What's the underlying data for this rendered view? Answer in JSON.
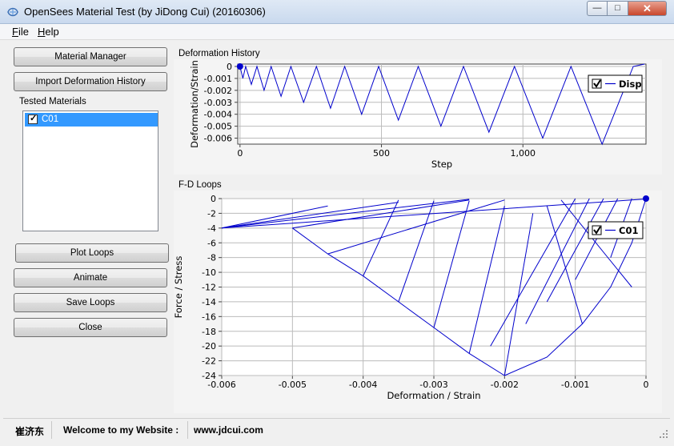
{
  "window": {
    "title": "OpenSees Material Test (by JiDong Cui) (20160306)",
    "min_glyph": "—",
    "max_glyph": "□",
    "close_glyph": "✕"
  },
  "menu": [
    {
      "accel": "F",
      "rest": "ile"
    },
    {
      "accel": "H",
      "rest": "elp"
    }
  ],
  "buttons": {
    "material_manager": "Material Manager",
    "import_history": "Import Deformation History",
    "plot_loops": "Plot Loops",
    "animate": "Animate",
    "save_loops": "Save Loops",
    "close": "Close"
  },
  "tested_materials": {
    "label": "Tested Materials",
    "items": [
      {
        "name": "C01",
        "checked": true
      }
    ]
  },
  "deformation_history": {
    "panel_title": "Deformation History",
    "accent": "#0000cc"
  },
  "fd_loops": {
    "panel_title": "F-D Loops"
  },
  "status": {
    "author": "崔济东",
    "welcome": "Welcome to my Website :",
    "url": "www.jdcui.com"
  },
  "chart_data": [
    {
      "type": "line",
      "title": "Deformation History",
      "xlabel": "Step",
      "ylabel": "Deformation/Strain",
      "xlim": [
        -8,
        1435
      ],
      "ylim": [
        -0.0065,
        0.0002
      ],
      "xticks": [
        0,
        500,
        1000
      ],
      "xtick_labels": [
        "0",
        "500",
        "1,000"
      ],
      "yticks": [
        0,
        -0.001,
        -0.002,
        -0.003,
        -0.004,
        -0.005,
        -0.006
      ],
      "ytick_labels": [
        "0",
        "-0.001",
        "-0.002",
        "-0.003",
        "-0.004",
        "-0.005",
        "-0.006"
      ],
      "grid": true,
      "legend": {
        "position": "top-right",
        "entries": [
          "Disp"
        ]
      },
      "series": [
        {
          "name": "Disp",
          "color": "#0000cc",
          "x": [
            0,
            10,
            20,
            40,
            60,
            85,
            110,
            145,
            180,
            225,
            270,
            320,
            370,
            430,
            490,
            560,
            630,
            710,
            790,
            880,
            970,
            1070,
            1170,
            1280,
            1390,
            1430
          ],
          "y": [
            0,
            -0.001,
            0,
            -0.0015,
            0,
            -0.002,
            0,
            -0.0025,
            0,
            -0.003,
            0,
            -0.0035,
            0,
            -0.004,
            0,
            -0.0045,
            0,
            -0.005,
            0,
            -0.0055,
            0,
            -0.006,
            0,
            -0.0065,
            0,
            0.0002
          ]
        }
      ],
      "markers": [
        {
          "x": 0,
          "y": 0
        }
      ]
    },
    {
      "type": "line",
      "title": "F-D Loops",
      "xlabel": "Deformation / Strain",
      "ylabel": "Force / Stress",
      "xlim": [
        -0.006,
        0
      ],
      "ylim": [
        -24,
        0
      ],
      "xticks": [
        -0.006,
        -0.005,
        -0.004,
        -0.003,
        -0.002,
        -0.001,
        0
      ],
      "xtick_labels": [
        "-0.006",
        "-0.005",
        "-0.004",
        "-0.003",
        "-0.002",
        "-0.001",
        "0"
      ],
      "yticks": [
        0,
        -2,
        -4,
        -6,
        -8,
        -10,
        -12,
        -14,
        -16,
        -18,
        -20,
        -22,
        -24
      ],
      "ytick_labels": [
        "0",
        "-2",
        "-4",
        "-6",
        "-8",
        "-10",
        "-12",
        "-14",
        "-16",
        "-18",
        "-20",
        "-22",
        "-24"
      ],
      "grid": true,
      "legend": {
        "position": "top-right",
        "entries": [
          "C01"
        ]
      },
      "series": [
        {
          "name": "C01",
          "color": "#0000cc",
          "polylines": [
            {
              "x": [
                0,
                -0.0002,
                -0.0005,
                -0.0009,
                -0.0014,
                -0.002
              ],
              "y": [
                0,
                -6,
                -12,
                -17,
                -21.5,
                -24
              ]
            },
            {
              "x": [
                -0.002,
                -0.0025,
                -0.003,
                -0.0035,
                -0.004,
                -0.0045,
                -0.005
              ],
              "y": [
                -24,
                -21,
                -17.5,
                -14,
                -10.5,
                -7.5,
                -4
              ]
            },
            {
              "x": [
                -0.0002,
                -0.0005
              ],
              "y": [
                0,
                -8
              ]
            },
            {
              "x": [
                -0.0004,
                -0.001
              ],
              "y": [
                0,
                -11
              ]
            },
            {
              "x": [
                -0.0006,
                -0.0014
              ],
              "y": [
                0,
                -14
              ]
            },
            {
              "x": [
                -0.0008,
                -0.0017
              ],
              "y": [
                0,
                -17
              ]
            },
            {
              "x": [
                -0.001,
                -0.0022
              ],
              "y": [
                0,
                -20
              ]
            },
            {
              "x": [
                -0.0012,
                -0.0002
              ],
              "y": [
                -0.2,
                -12
              ]
            },
            {
              "x": [
                -0.0014,
                -0.0009
              ],
              "y": [
                -1,
                -17
              ]
            },
            {
              "x": [
                -0.0016,
                -0.002
              ],
              "y": [
                -2,
                -24
              ]
            },
            {
              "x": [
                -0.002,
                -0.0025
              ],
              "y": [
                -1,
                -21
              ]
            },
            {
              "x": [
                -0.0025,
                -0.003
              ],
              "y": [
                -0.3,
                -17.5
              ]
            },
            {
              "x": [
                -0.003,
                -0.0035
              ],
              "y": [
                -0.3,
                -14
              ]
            },
            {
              "x": [
                -0.0035,
                -0.004
              ],
              "y": [
                -0.2,
                -10.5
              ]
            },
            {
              "x": [
                -0.0045,
                -0.002
              ],
              "y": [
                -7.5,
                -0.2
              ]
            },
            {
              "x": [
                -0.005,
                -0.0025
              ],
              "y": [
                -4,
                -0.2
              ]
            },
            {
              "x": [
                -0.006,
                -0.0025
              ],
              "y": [
                -4,
                -0.1
              ]
            },
            {
              "x": [
                -0.006,
                -0.0035
              ],
              "y": [
                -4,
                -0.5
              ]
            },
            {
              "x": [
                -0.006,
                -0.0045
              ],
              "y": [
                -4,
                -1
              ]
            },
            {
              "x": [
                -0.006,
                0
              ],
              "y": [
                -4,
                -0.05
              ]
            }
          ]
        }
      ],
      "markers": [
        {
          "x": 0,
          "y": 0
        }
      ]
    }
  ]
}
